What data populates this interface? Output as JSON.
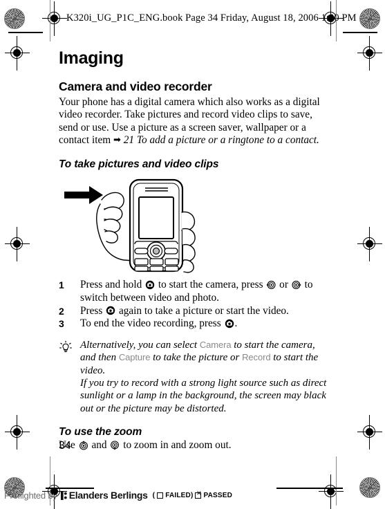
{
  "prepress": {
    "file_header": "K320i_UG_P1C_ENG.book  Page 34  Friday, August 18, 2006 1:00 PM",
    "registration_icon": "registration-target-icon",
    "star_target_icon": "star-target-icon"
  },
  "content": {
    "chapter_title": "Imaging",
    "section_title": "Camera and video recorder",
    "intro_text": "Your phone has a digital camera which also works as a digital video recorder. Take pictures and record video clips to save, send or use. Use a picture as a screen saver, wallpaper or a contact item ",
    "intro_arrow": "➡",
    "intro_xref": "21 To add a picture or a ringtone to a contact.",
    "procedure_title": "To take pictures and video clips",
    "illustration_alt": "hand-holding-phone-illustration",
    "steps": [
      {
        "num": "1",
        "part1": "Press and hold ",
        "key1": "camera-key-icon",
        "part2": " to start the camera, press ",
        "key2": "nav-key-left-icon",
        "part3": " or ",
        "key3": "nav-key-right-icon",
        "part4": " to switch between video and photo."
      },
      {
        "num": "2",
        "part1": "Press ",
        "key1": "camera-key-icon",
        "part2": " again to take a picture or start the video."
      },
      {
        "num": "3",
        "part1": "To end the video recording, press ",
        "key1": "camera-key-icon",
        "part2": "."
      }
    ],
    "tip": {
      "icon": "lightbulb-icon",
      "line1_a": "Alternatively, you can select ",
      "term_camera": "Camera",
      "line1_b": " to start the camera, and then ",
      "term_capture": "Capture",
      "line1_c": " to take the picture or ",
      "term_record": "Record",
      "line1_d": " to start the video.",
      "line2": "If you try to record with a strong light source such as direct sunlight or a lamp in the background, the screen may black out or the picture may be distorted."
    },
    "zoom_title": "To use the zoom",
    "zoom_text_a": "Use ",
    "zoom_key_up": "nav-key-up-icon",
    "zoom_text_b": " and ",
    "zoom_key_down": "nav-key-down-icon",
    "zoom_text_c": " to zoom in and zoom out."
  },
  "page_number": "34",
  "preflight": {
    "by_label": "Preflighted by",
    "brand": "Elanders Berlings",
    "open_paren": "(",
    "failed_label": "FAILED",
    "close_paren": ")",
    "passed_label": "PASSED"
  }
}
